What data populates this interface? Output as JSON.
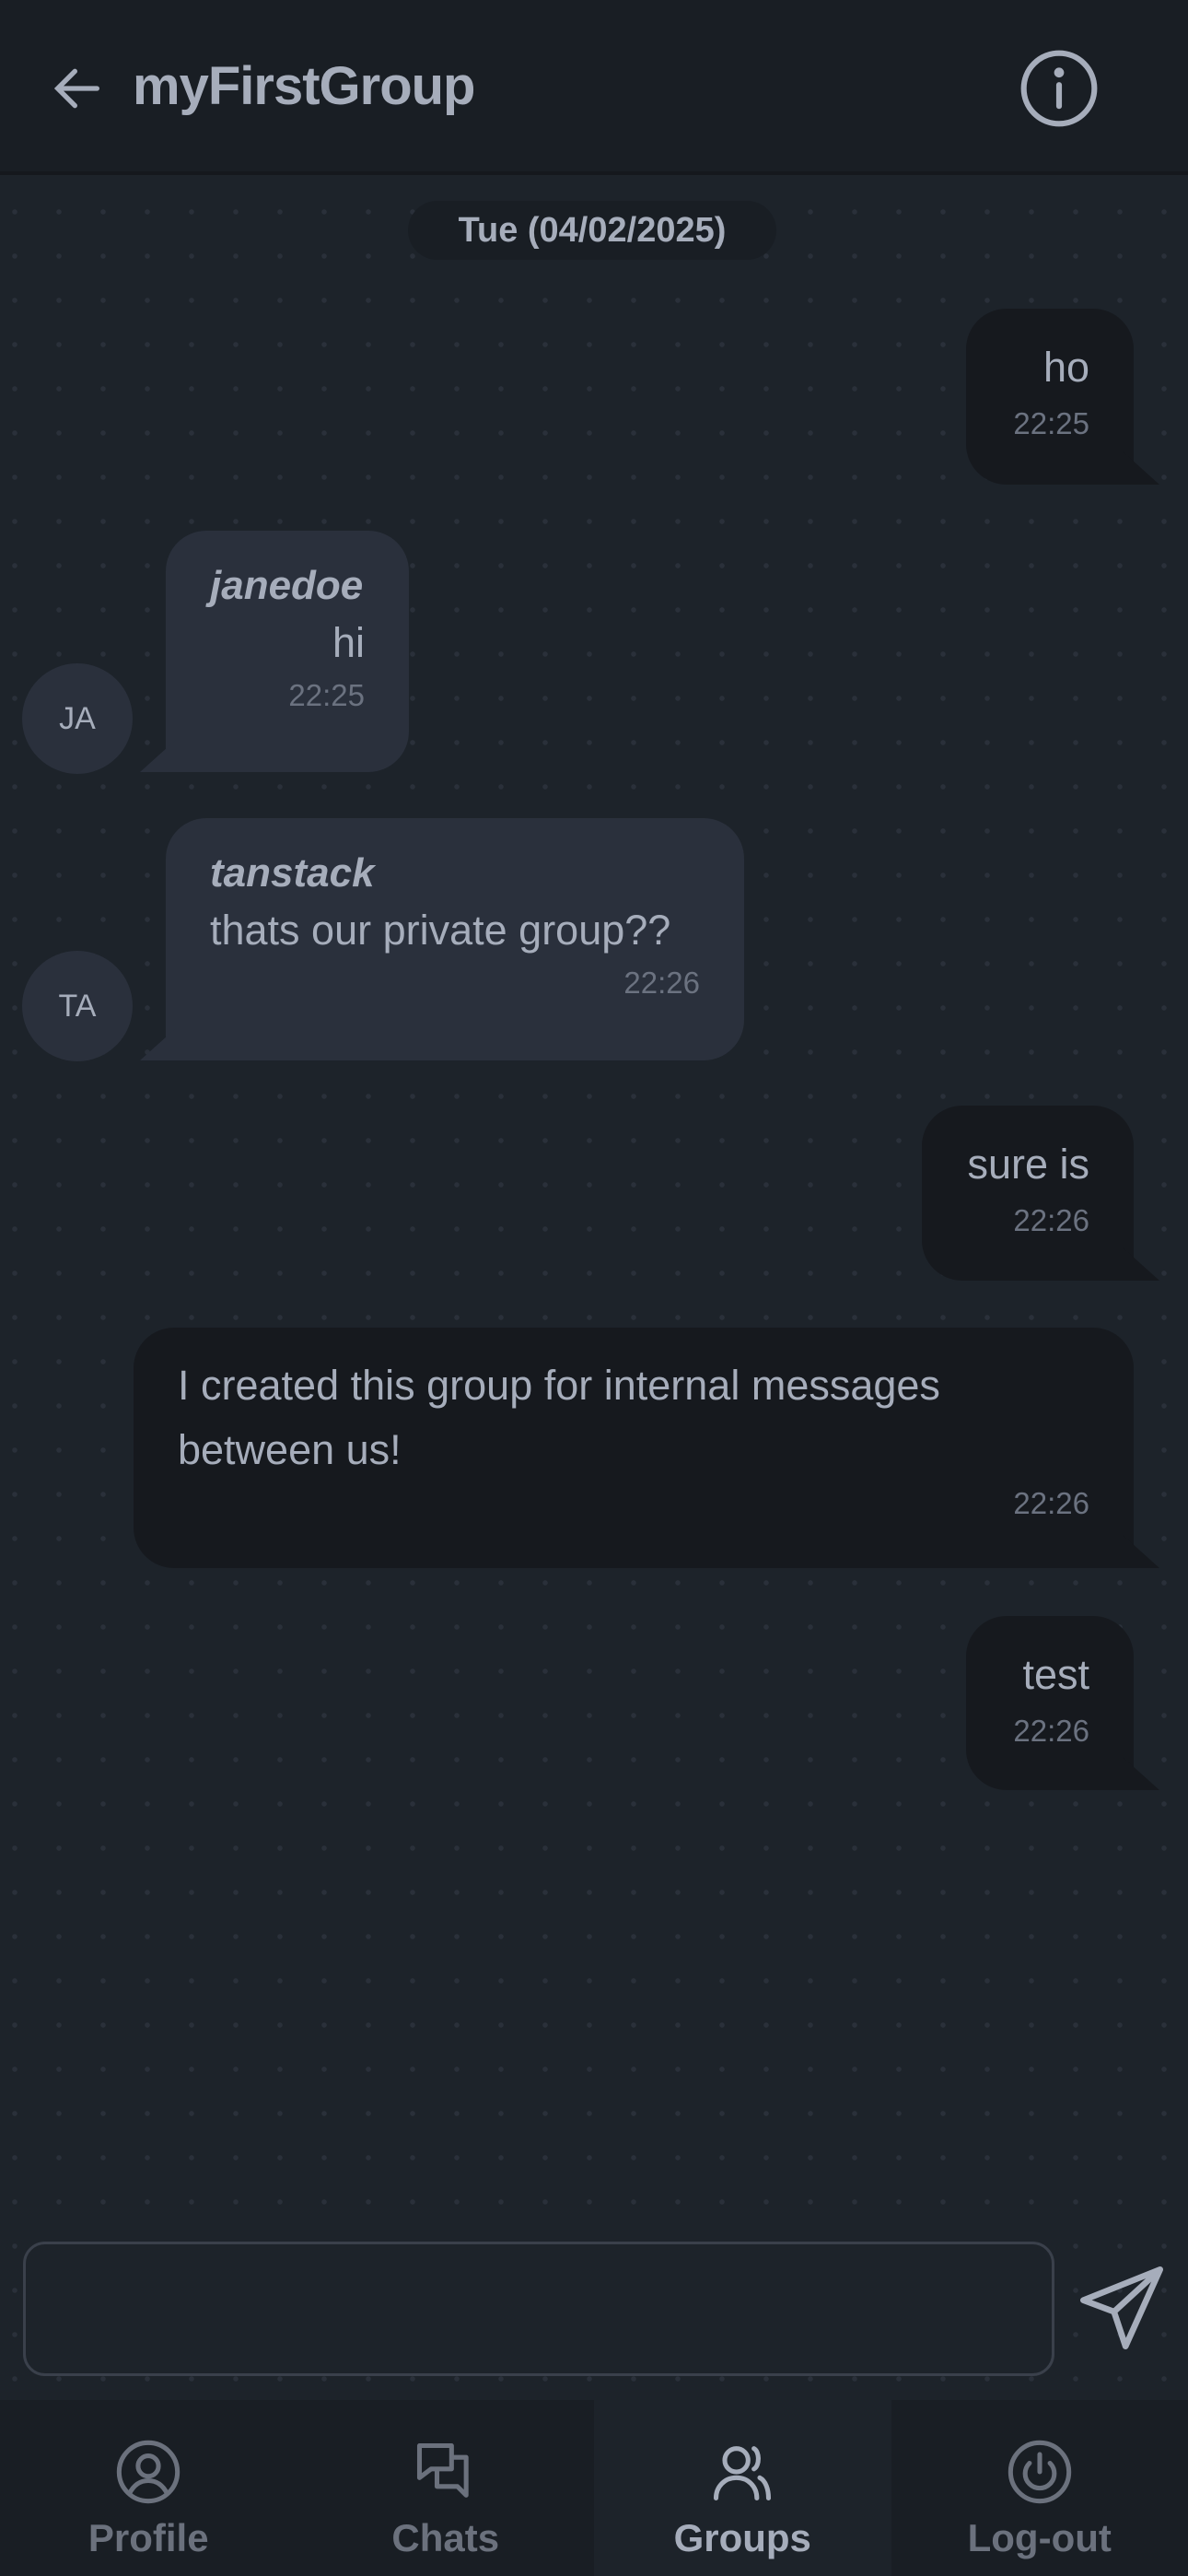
{
  "header": {
    "title": "myFirstGroup",
    "back_icon": "arrow-left-icon",
    "info_icon": "info-circle-icon"
  },
  "date_separator": "Tue (04/02/2025)",
  "messages": [
    {
      "own": true,
      "text": "ho",
      "time": "22:25"
    },
    {
      "own": false,
      "user": "janedoe",
      "avatar": "JA",
      "text": "hi",
      "time": "22:25"
    },
    {
      "own": false,
      "user": "tanstack",
      "avatar": "TA",
      "text": "thats our private group??",
      "time": "22:26"
    },
    {
      "own": true,
      "text": "sure is",
      "time": "22:26"
    },
    {
      "own": true,
      "text": "I created this group for internal messages between us!",
      "time": "22:26"
    },
    {
      "own": true,
      "text": "test",
      "time": "22:26"
    }
  ],
  "composer": {
    "value": "",
    "placeholder": "",
    "send_icon": "paper-plane-icon"
  },
  "nav": [
    {
      "label": "Profile",
      "icon": "user-circle-icon",
      "active": false
    },
    {
      "label": "Chats",
      "icon": "chat-bubbles-icon",
      "active": false
    },
    {
      "label": "Groups",
      "icon": "users-icon",
      "active": true
    },
    {
      "label": "Log-out",
      "icon": "power-icon",
      "active": false
    }
  ],
  "colors": {
    "background": "#1d232a",
    "header": "#191e24",
    "own_bubble": "#16191e",
    "other_bubble": "#2a303c",
    "text": "#a6adbb"
  }
}
